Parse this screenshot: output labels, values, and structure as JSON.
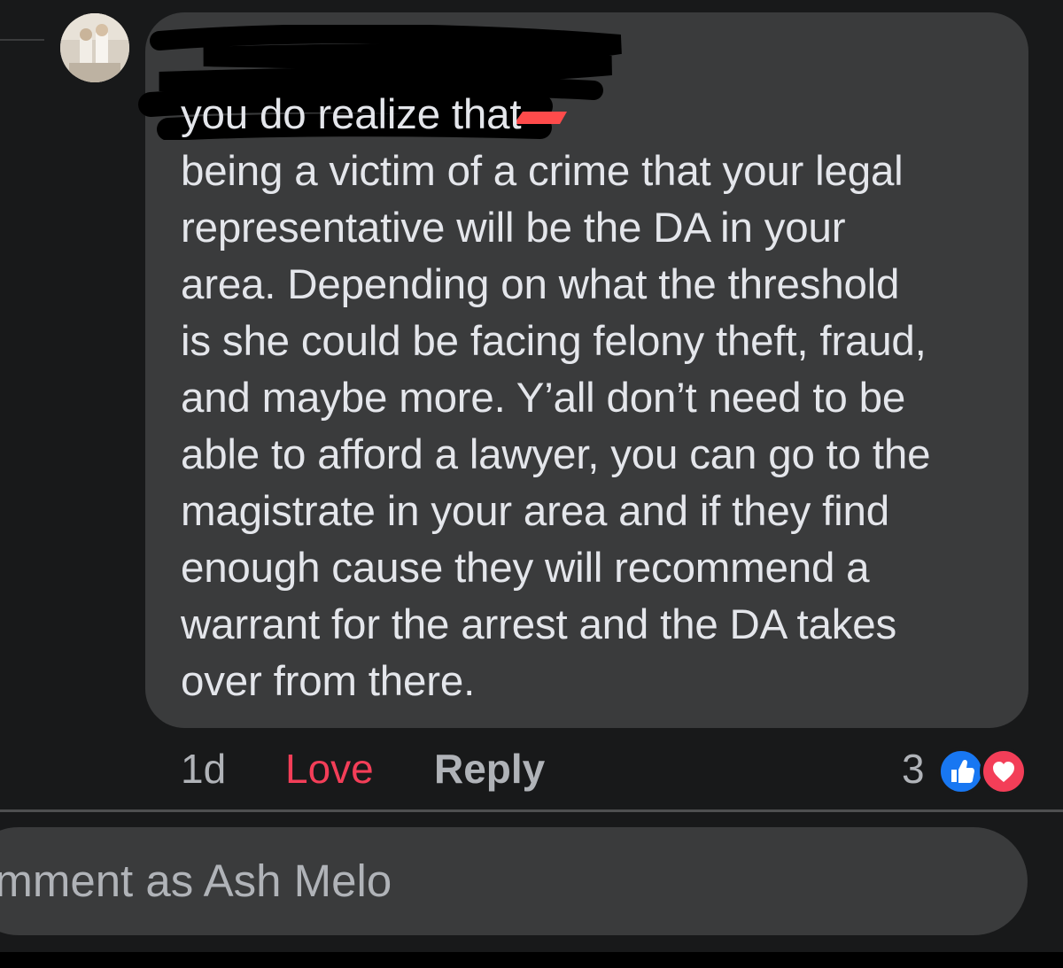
{
  "comment": {
    "text": "you do realize that\nbeing a victim of a crime that your legal\nrepresentative will be the DA in your\narea. Depending on what the threshold\nis she could be facing felony theft, fraud,\nand maybe more. Y’all don’t need to be\nable to afford a lawyer, you can go to the\nmagistrate in your area and if they find\nenough cause they will recommend a\nwarrant for the arrest and the DA takes\nover from there.",
    "timestamp": "1d",
    "love_label": "Love",
    "reply_label": "Reply",
    "reaction_count": "3",
    "reaction_icons": [
      "like-icon",
      "love-icon"
    ]
  },
  "composer": {
    "placeholder": "omment as Ash Melo"
  },
  "colors": {
    "background": "#18191a",
    "bubble": "#3a3b3c",
    "text": "#e4e6eb",
    "secondary_text": "#b0b3b8",
    "love": "#f33e58",
    "like": "#1877f2"
  }
}
